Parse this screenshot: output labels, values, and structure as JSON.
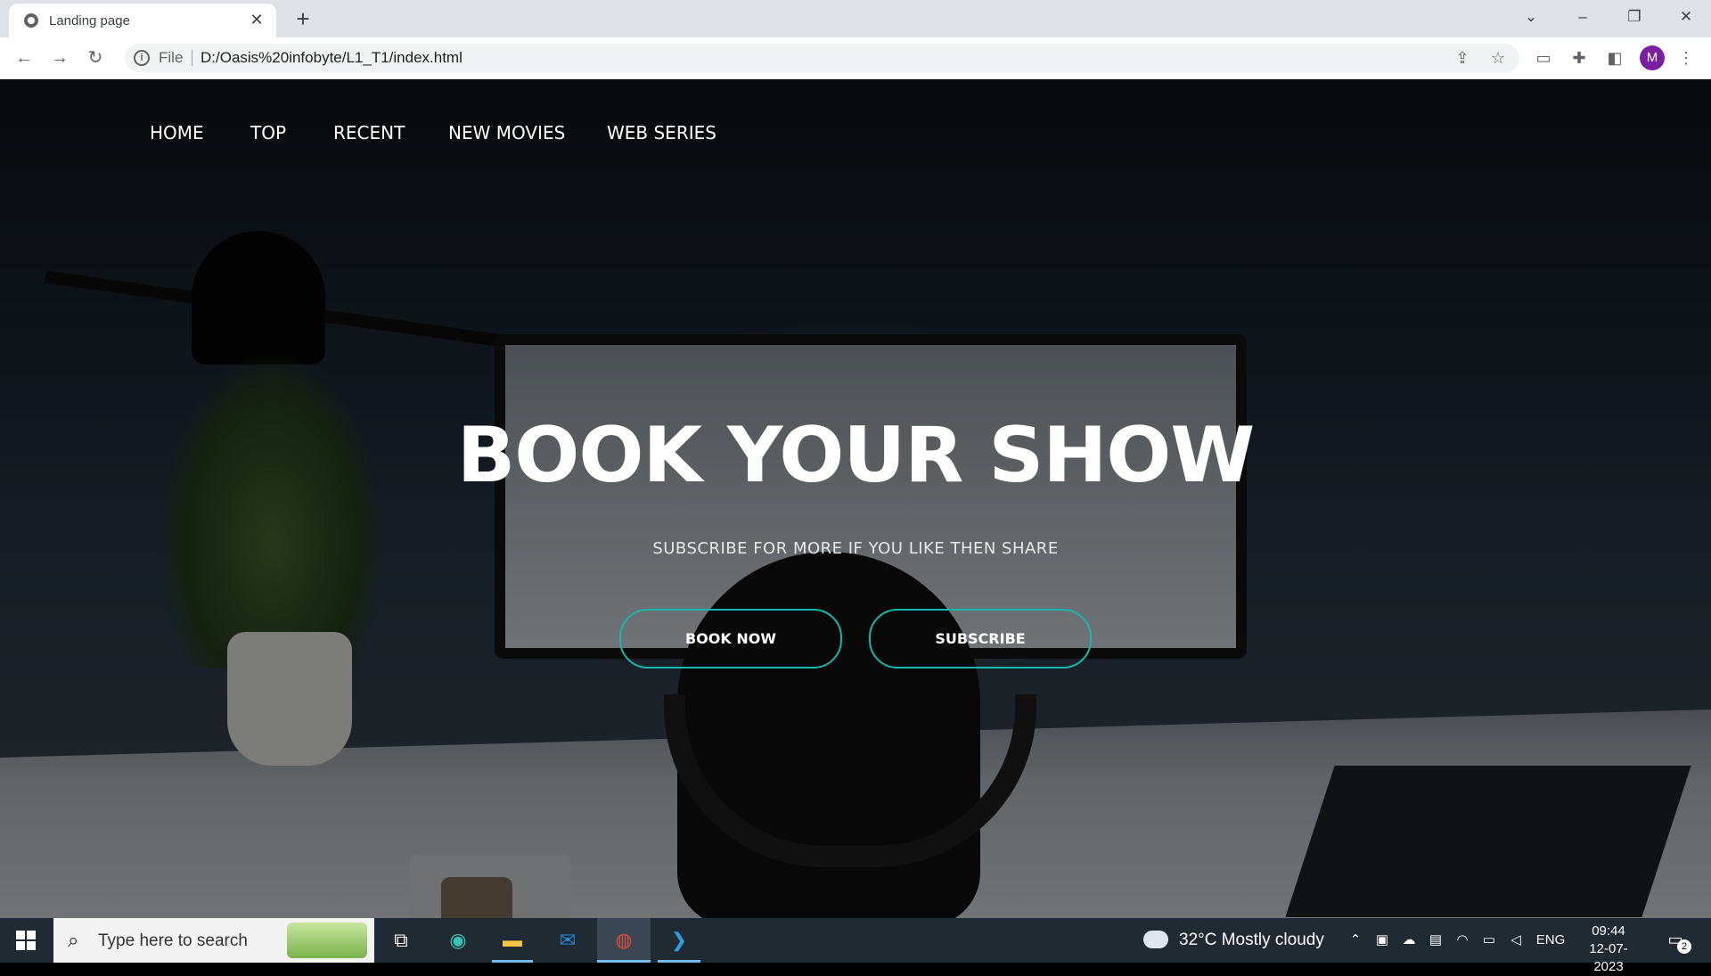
{
  "browser": {
    "tab_title": "Landing page",
    "tab_close": "✕",
    "new_tab": "+",
    "omnibox_scheme": "File",
    "omnibox_url": "D:/Oasis%20infobyte/L1_T1/index.html",
    "profile_initial": "M"
  },
  "site": {
    "nav": [
      "HOME",
      "TOP",
      "RECENT",
      "NEW MOVIES",
      "WEB SERIES"
    ],
    "hero_title": "BOOK YOUR SHOW",
    "hero_subtitle": "SUBSCRIBE FOR MORE IF YOU LIKE THEN SHARE",
    "buttons": [
      "BOOK NOW",
      "SUBSCRIBE"
    ],
    "accent_color": "#19b6ac"
  },
  "taskbar": {
    "search_placeholder": "Type here to search",
    "weather": "32°C  Mostly cloudy",
    "language": "ENG",
    "time": "09:44",
    "date": "12-07-2023",
    "notification_count": "2"
  }
}
